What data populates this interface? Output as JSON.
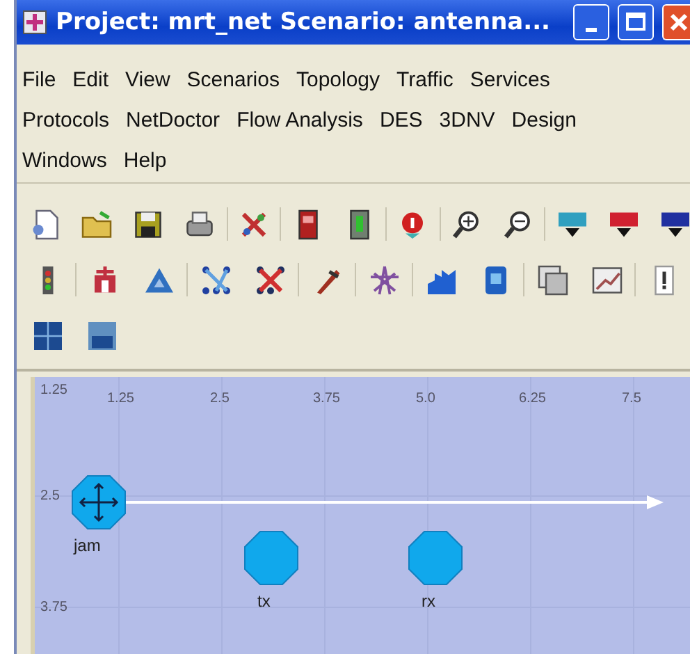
{
  "window": {
    "title": "Project: mrt_net Scenario: antenna..."
  },
  "menu": [
    "File",
    "Edit",
    "View",
    "Scenarios",
    "Topology",
    "Traffic",
    "Services",
    "Protocols",
    "NetDoctor",
    "Flow Analysis",
    "DES",
    "3DNV",
    "Design",
    "Windows",
    "Help"
  ],
  "workspace": {
    "corner_label": "1.25",
    "x_ticks": [
      "1.25",
      "2.5",
      "3.75",
      "5.0",
      "6.25",
      "7.5"
    ],
    "y_ticks": [
      "2.5",
      "3.75"
    ],
    "nodes": [
      {
        "label": "jam",
        "kind": "jammer"
      },
      {
        "label": "tx",
        "kind": "station"
      },
      {
        "label": "rx",
        "kind": "station"
      }
    ]
  }
}
